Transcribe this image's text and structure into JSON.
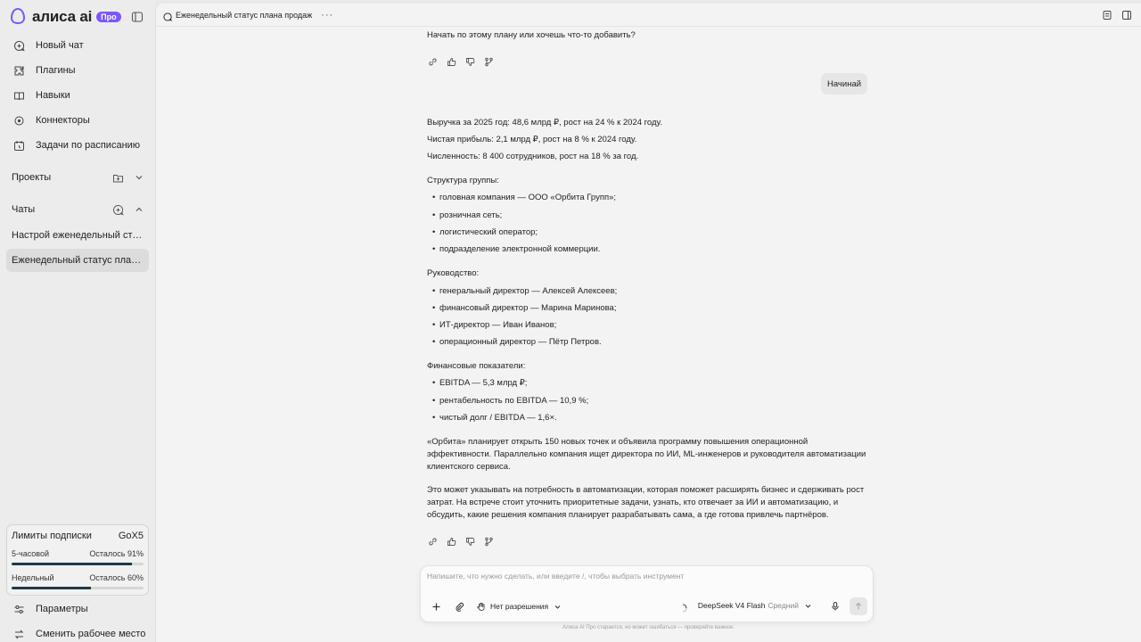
{
  "brand": {
    "name": "алиса ai",
    "badge": "Про"
  },
  "nav": [
    {
      "label": "Новый чат",
      "icon": "new-chat-icon"
    },
    {
      "label": "Плагины",
      "icon": "plugin-icon"
    },
    {
      "label": "Навыки",
      "icon": "book-icon"
    },
    {
      "label": "Коннекторы",
      "icon": "connector-icon"
    },
    {
      "label": "Задачи по расписанию",
      "icon": "schedule-icon"
    }
  ],
  "sections": {
    "projects": "Проекты",
    "chats": "Чаты"
  },
  "chats": [
    {
      "title": "Настрой еженедельный статус плана продаж"
    },
    {
      "title": "Еженедельный статус плана продаж"
    }
  ],
  "limits": {
    "title": "Лимиты подписки",
    "plan": "GoX5",
    "five_hour": {
      "label": "5-часовой",
      "remaining": "Осталось 91%",
      "value": 0.91
    },
    "weekly": {
      "label": "Недельный",
      "remaining": "Осталось 60%",
      "value": 0.6
    }
  },
  "bottom_nav": [
    {
      "label": "Параметры",
      "icon": "settings-icon"
    },
    {
      "label": "Сменить рабочее место",
      "icon": "workspace-icon"
    }
  ],
  "topbar": {
    "title": "Еженедельный статус плана продаж",
    "more": "···"
  },
  "messages": {
    "prev_question": "Начать по этому плану или хочешь что-то добавить?",
    "user_reply": "Начинай",
    "revenue": "Выручка за 2025 год: 48,6 млрд ₽, рост на 24 % к 2024 году.",
    "profit": "Чистая прибыль: 2,1 млрд ₽, рост на 8 % к 2024 году.",
    "headcount": "Численность: 8 400 сотрудников, рост на 18 % за год.",
    "structure_title": "Структура группы:",
    "structure": [
      "головная компания — ООО «Орбита Групп»;",
      "розничная сеть;",
      "логистический оператор;",
      "подразделение электронной коммерции."
    ],
    "management_title": "Руководство:",
    "management": [
      "генеральный директор — Алексей Алексеев;",
      "финансовый директор — Марина Маринова;",
      "ИТ-директор — Иван Иванов;",
      "операционный директор — Пётр Петров."
    ],
    "finance_title": "Финансовые показатели:",
    "finance": [
      "EBITDA — 5,3 млрд ₽;",
      "рентабельность по EBITDA — 10,9 %;",
      "чистый долг / EBITDA — 1,6×."
    ],
    "para1": "«Орбита» планирует открыть 150 новых точек и объявила программу повышения операционной эффективности. Параллельно компания ищет директора по ИИ, ML-инженеров и руководителя автоматизации клиентского сервиса.",
    "para2": "Это может указывать на потребность в автоматизации, которая поможет расширять бизнес и сдерживать рост затрат. На встрече стоит уточнить приоритетные задачи, узнать, кто отвечает за ИИ и автоматизацию, и обсудить, какие решения компания планирует разрабатывать сама, а где готова привлечь партнёров."
  },
  "composer": {
    "placeholder": "Напишите, что нужно сделать, или введите /, чтобы выбрать инструмент",
    "permission": "Нет разрешения",
    "model": "DeepSeek V4 Flash",
    "effort": "Средний"
  },
  "footnote": "Алиса AI Про старается, но может ошибаться — проверяйте важное.",
  "colors": {
    "accent": "#7b57ff",
    "bar_fill": "#1e3a4b"
  }
}
